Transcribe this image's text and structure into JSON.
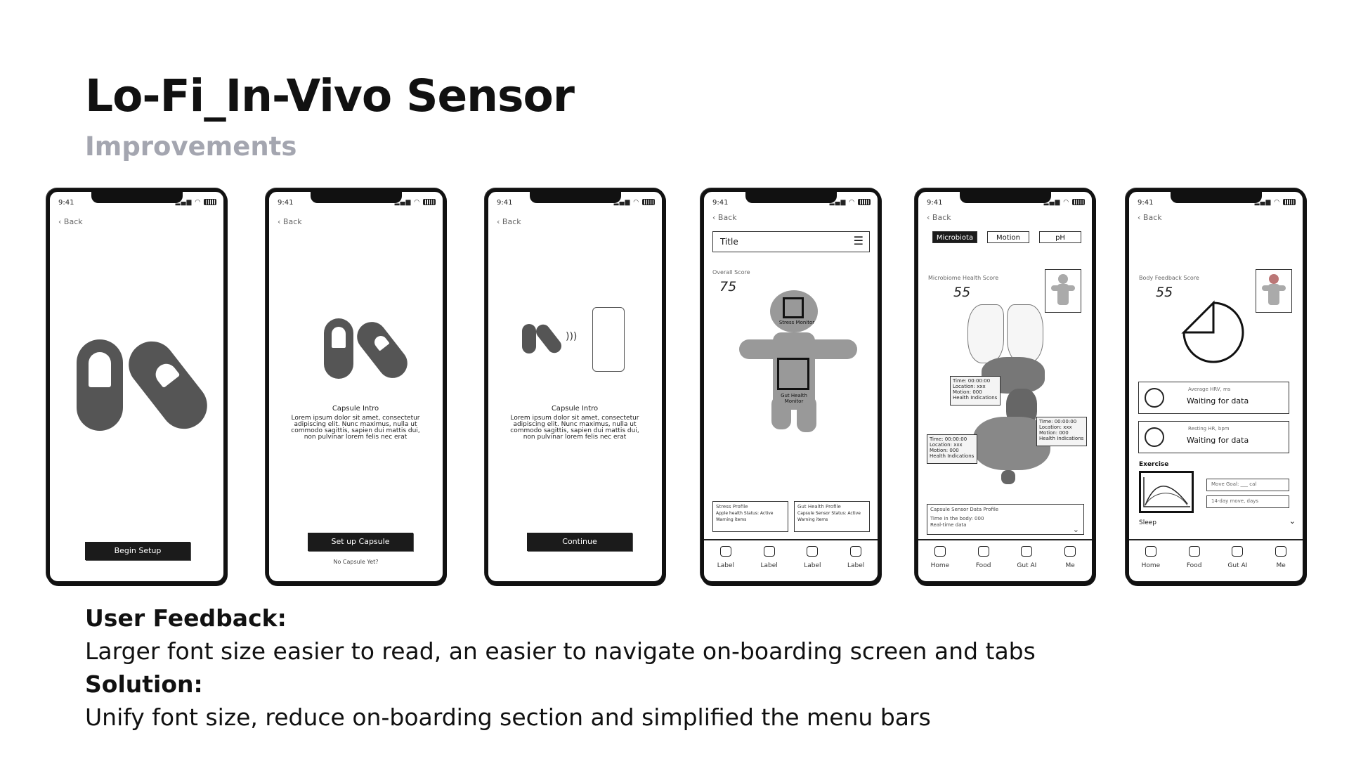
{
  "title": "Lo-Fi_In-Vivo Sensor",
  "subtitle": "Improvements",
  "feedback": {
    "heading": "User Feedback:",
    "text": "Larger font size easier to read, an easier to navigate on-boarding screen and tabs",
    "solution_heading": "Solution:",
    "solution_text": "Unify font size, reduce on-boarding section and simplified the menu bars"
  },
  "common": {
    "time": "9:41",
    "back": "Back"
  },
  "screen1": {
    "button": "Begin Setup"
  },
  "screen2": {
    "heading": "Capsule Intro",
    "body": "Lorem ipsum dolor sit amet, consectetur adipiscing elit. Nunc maximus, nulla ut commodo sagittis, sapien dui mattis dui, non pulvinar lorem felis nec erat",
    "button": "Set up Capsule",
    "link": "No Capsule Yet?"
  },
  "screen3": {
    "heading": "Capsule Intro",
    "body": "Lorem ipsum dolor sit amet, consectetur adipiscing elit. Nunc maximus, nulla ut commodo sagittis, sapien dui mattis dui, non pulvinar lorem felis nec erat",
    "button": "Continue"
  },
  "screen4": {
    "title": "Title",
    "score_label": "Overall Score",
    "score": "75",
    "stress": "Stress Monitor",
    "gut": "Gut Health Monitor",
    "card1_title": "Stress Profile",
    "card1_l1": "Apple health Status: Active",
    "card1_l2": "Warning items",
    "card2_title": "Gut Health Profile",
    "card2_l1": "Capsule Sensor Status: Active",
    "card2_l2": "Warning items",
    "tabs": [
      "Label",
      "Label",
      "Label",
      "Label"
    ]
  },
  "screen5": {
    "seg": [
      "Microbiota",
      "Motion",
      "pH"
    ],
    "score_label": "Microbiome Health Score",
    "score": "55",
    "info_time": "Time: 00:00:00",
    "info_loc": "Location: xxx",
    "info_motion": "Motion: 000",
    "info_health": "Health Indications",
    "bottom_title": "Capsule Sensor Data Profile",
    "bottom_l1": "Time in the body: 000",
    "bottom_l2": "Real-time data",
    "tabs": [
      "Home",
      "Food",
      "Gut AI",
      "Me"
    ]
  },
  "screen6": {
    "score_label": "Body Feedback Score",
    "score": "55",
    "score_fraction": 0.75,
    "row1_label": "Average HRV, ms",
    "row1_value": "Waiting for data",
    "row2_label": "Resting HR, bpm",
    "row2_value": "Waiting for data",
    "exercise": "Exercise",
    "move": "Move Goal: ___ cal",
    "days": "14-day move, days",
    "sleep": "Sleep",
    "tabs": [
      "Home",
      "Food",
      "Gut AI",
      "Me"
    ]
  }
}
